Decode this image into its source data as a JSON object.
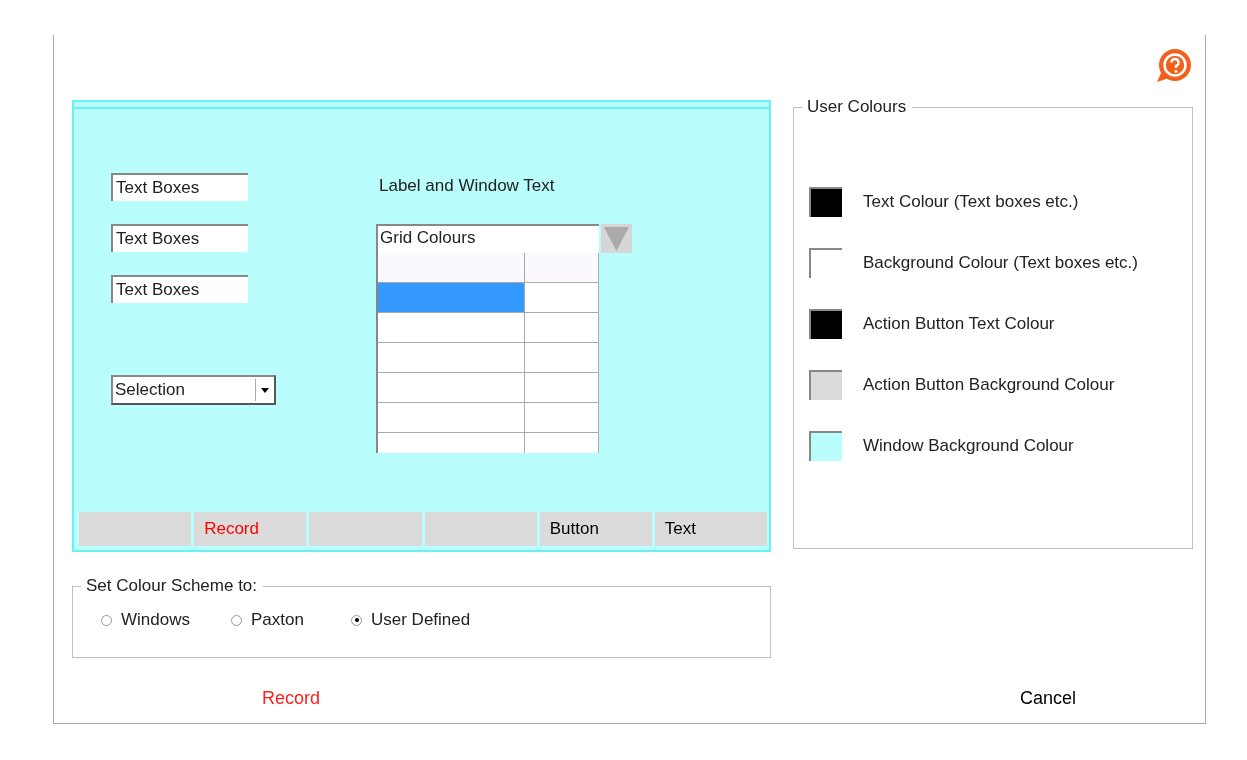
{
  "preview": {
    "text_boxes": [
      "Text Boxes",
      "Text Boxes",
      "Text Boxes"
    ],
    "selection": {
      "value": "Selection"
    },
    "label_text": "Label and Window Text",
    "grid_combo": {
      "value": "Grid Colours"
    },
    "grid_rows": [
      {
        "kind": "header",
        "selected": false
      },
      {
        "kind": "row",
        "selected": true
      },
      {
        "kind": "row",
        "selected": false
      },
      {
        "kind": "row",
        "selected": false
      },
      {
        "kind": "row",
        "selected": false
      },
      {
        "kind": "row",
        "selected": false
      },
      {
        "kind": "row",
        "selected": false
      }
    ],
    "buttons": [
      {
        "kind": "blank"
      },
      {
        "kind": "label",
        "label": "Record",
        "color": "#ff0000"
      },
      {
        "kind": "blank"
      },
      {
        "kind": "blank"
      },
      {
        "kind": "label",
        "label": "Button",
        "color": "#000000"
      },
      {
        "kind": "label",
        "label": "Text",
        "color": "#000000"
      }
    ]
  },
  "user_colours": {
    "title": "User Colours",
    "items": [
      {
        "label": "Text Colour (Text boxes etc.)",
        "color": "#000000"
      },
      {
        "label": "Background Colour (Text boxes etc.)",
        "color": "#ffffff"
      },
      {
        "label": "Action Button Text Colour",
        "color": "#000000"
      },
      {
        "label": "Action Button Background Colour",
        "color": "#dcdbdc"
      },
      {
        "label": "Window Background Colour",
        "color": "#b9fdfd"
      }
    ]
  },
  "colour_scheme": {
    "title": "Set Colour Scheme to:",
    "options": [
      {
        "label": "Windows",
        "selected": false
      },
      {
        "label": "Paxton",
        "selected": false
      },
      {
        "label": "User Defined",
        "selected": true
      }
    ]
  },
  "actions": [
    {
      "label": "Record",
      "color": "#ff2020"
    },
    {
      "label": "Cancel",
      "color": "#000000"
    }
  ]
}
